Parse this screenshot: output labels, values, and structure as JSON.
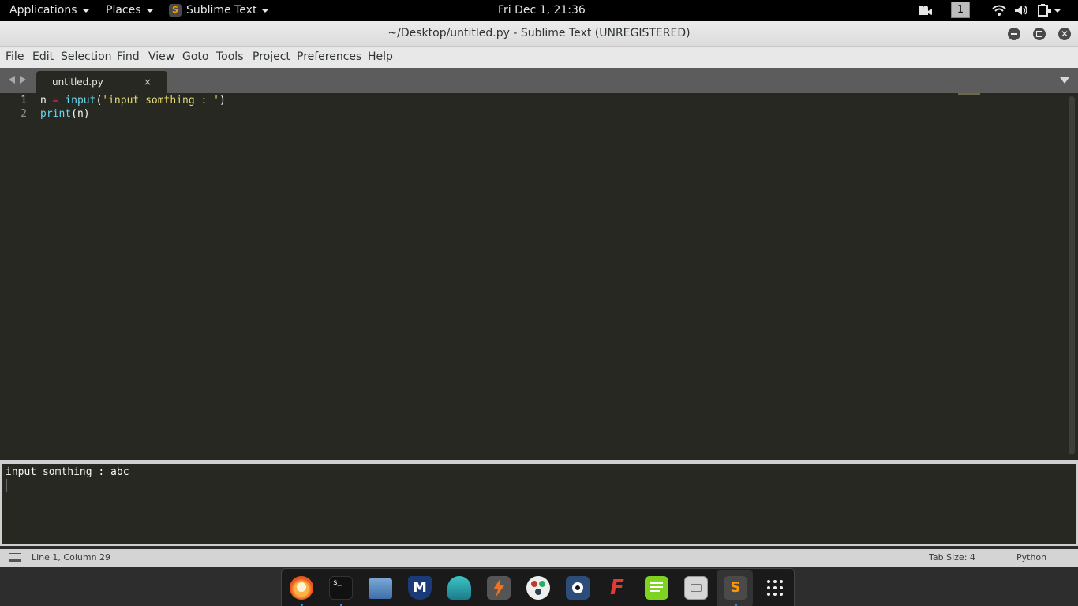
{
  "topbar": {
    "applications": "Applications",
    "places": "Places",
    "app_name": "Sublime Text",
    "clock": "Fri Dec  1, 21:36",
    "workspace": "1",
    "icons": [
      "video-icon",
      "wifi-icon",
      "volume-icon",
      "battery-icon"
    ]
  },
  "window": {
    "title": "~/Desktop/untitled.py - Sublime Text (UNREGISTERED)",
    "buttons": [
      "minimize-icon",
      "maximize-icon",
      "close-icon"
    ]
  },
  "menubar": {
    "items": [
      "File",
      "Edit",
      "Selection",
      "Find",
      "View",
      "Goto",
      "Tools",
      "Project",
      "Preferences",
      "Help"
    ]
  },
  "tabs": [
    {
      "label": "untitled.py",
      "close": "×",
      "active": true
    }
  ],
  "editor": {
    "line_numbers": [
      "1",
      "2"
    ],
    "lines": [
      {
        "var": "n ",
        "op": "=",
        "sp": " ",
        "fn": "input",
        "open": "(",
        "str": "'input somthing : '",
        "close": ")"
      },
      {
        "fn": "print",
        "rest": "(n)"
      }
    ]
  },
  "output": {
    "text": "input somthing : abc"
  },
  "statusbar": {
    "position": "Line 1, Column 29",
    "tab_size": "Tab Size: 4",
    "syntax": "Python"
  },
  "dock": {
    "apps": [
      "firefox-icon",
      "terminal-icon",
      "files-icon",
      "metasploit-icon",
      "armitage-icon",
      "burpsuite-icon",
      "maltego-icon",
      "beef-icon",
      "faraday-icon",
      "notes-icon",
      "screenshot-icon",
      "sublime-text-icon",
      "show-apps-icon"
    ],
    "terminal_glyph": "$_",
    "sublime_glyph": "S",
    "metasploit_glyph": "M",
    "faraday_glyph": "F"
  },
  "colors": {
    "editor_bg": "#272822",
    "keyword": "#f92672",
    "function": "#66d9ef",
    "string": "#e6db74",
    "foreground": "#f8f8f2"
  }
}
